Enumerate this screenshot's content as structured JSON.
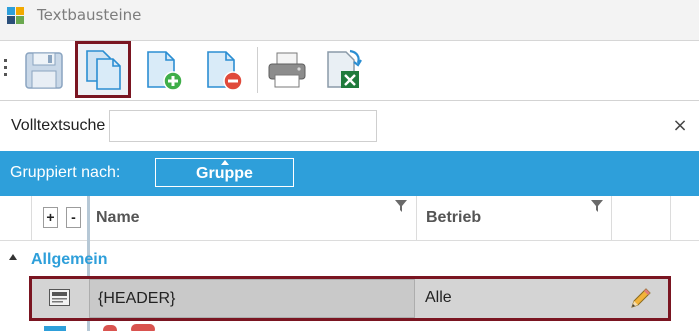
{
  "window": {
    "title": "Textbausteine"
  },
  "toolbar": {
    "buttons": [
      {
        "icon": "save-icon",
        "active": false
      },
      {
        "icon": "copy-document-icon",
        "active": true
      },
      {
        "icon": "add-document-icon",
        "active": false
      },
      {
        "icon": "remove-document-icon",
        "active": false
      },
      {
        "icon": "print-icon",
        "active": false
      },
      {
        "icon": "excel-export-icon",
        "active": false
      }
    ]
  },
  "search": {
    "label": "Volltextsuche",
    "value": "",
    "placeholder": "",
    "close_glyph": "×"
  },
  "grouping": {
    "label": "Gruppiert nach:",
    "chip": "Gruppe"
  },
  "grid": {
    "expand_label": "+",
    "collapse_label": "-",
    "columns": [
      "Name",
      "Betrieb"
    ],
    "groups": [
      {
        "name": "Allgemein",
        "rows": [
          {
            "name": "{HEADER}",
            "betrieb": "Alle",
            "selected": true
          }
        ]
      }
    ]
  },
  "colors": {
    "accent": "#2e9fda",
    "selection_border": "#7a1521",
    "group_text": "#2e9fda"
  }
}
